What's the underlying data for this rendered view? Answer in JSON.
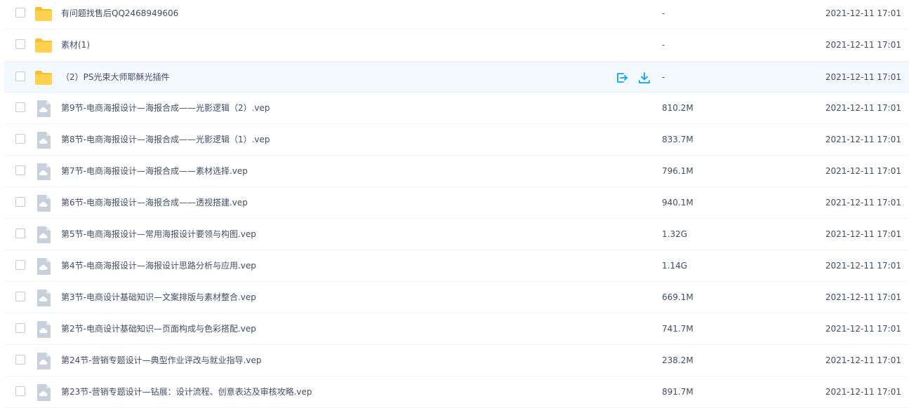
{
  "colors": {
    "folder": "#ffd14f",
    "folder_back": "#f5bf2f",
    "file_icon": "#c8d0dc",
    "action_blue": "#06a7ff",
    "row_hover_bg": "#f3f9ff",
    "text": "#424e67"
  },
  "rows": [
    {
      "type": "folder",
      "icon": "folder-icon",
      "name": "有问题找售后QQ2468949606",
      "size": "-",
      "modified": "2021-12-11 17:01",
      "hovered": false
    },
    {
      "type": "folder",
      "icon": "folder-icon",
      "name": "素材(1)",
      "size": "-",
      "modified": "2021-12-11 17:01",
      "hovered": false
    },
    {
      "type": "folder",
      "icon": "folder-icon",
      "name": "（2）PS光束大师耶稣光插件",
      "size": "-",
      "modified": "2021-12-11 17:01",
      "hovered": true,
      "actions": [
        {
          "icon": "share-icon"
        },
        {
          "icon": "download-icon"
        }
      ]
    },
    {
      "type": "file",
      "icon": "cloud-file-icon",
      "name": "第9节-电商海报设计—海报合成——光影逻辑（2）.vep",
      "size": "810.2M",
      "modified": "2021-12-11 17:01",
      "hovered": false
    },
    {
      "type": "file",
      "icon": "cloud-file-icon",
      "name": "第8节-电商海报设计—海报合成——光影逻辑（1）.vep",
      "size": "833.7M",
      "modified": "2021-12-11 17:01",
      "hovered": false
    },
    {
      "type": "file",
      "icon": "cloud-file-icon",
      "name": "第7节-电商海报设计—海报合成——素材选择.vep",
      "size": "796.1M",
      "modified": "2021-12-11 17:01",
      "hovered": false
    },
    {
      "type": "file",
      "icon": "cloud-file-icon",
      "name": "第6节-电商海报设计—海报合成——透视搭建.vep",
      "size": "940.1M",
      "modified": "2021-12-11 17:01",
      "hovered": false
    },
    {
      "type": "file",
      "icon": "cloud-file-icon",
      "name": "第5节-电商海报设计—常用海报设计要领与构图.vep",
      "size": "1.32G",
      "modified": "2021-12-11 17:01",
      "hovered": false
    },
    {
      "type": "file",
      "icon": "cloud-file-icon",
      "name": "第4节-电商海报设计—海报设计思路分析与应用.vep",
      "size": "1.14G",
      "modified": "2021-12-11 17:01",
      "hovered": false
    },
    {
      "type": "file",
      "icon": "cloud-file-icon",
      "name": "第3节-电商设计基础知识—文案排版与素材整合.vep",
      "size": "669.1M",
      "modified": "2021-12-11 17:01",
      "hovered": false
    },
    {
      "type": "file",
      "icon": "cloud-file-icon",
      "name": "第2节-电商设计基础知识—页面构成与色彩搭配.vep",
      "size": "741.7M",
      "modified": "2021-12-11 17:01",
      "hovered": false
    },
    {
      "type": "file",
      "icon": "cloud-file-icon",
      "name": "第24节-营销专题设计—典型作业评改与就业指导.vep",
      "size": "238.2M",
      "modified": "2021-12-11 17:01",
      "hovered": false
    },
    {
      "type": "file",
      "icon": "cloud-file-icon",
      "name": "第23节-营销专题设计—钻展：设计流程、创意表达及审核攻略.vep",
      "size": "891.7M",
      "modified": "2021-12-11 17:01",
      "hovered": false
    }
  ]
}
